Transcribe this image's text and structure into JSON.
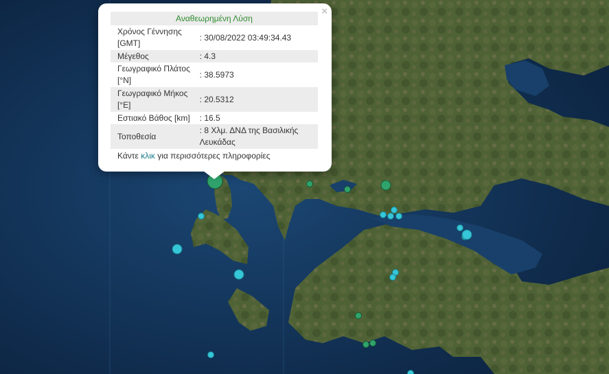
{
  "popup": {
    "title": "Αναθεωρημένη Λύση",
    "close_label": "×",
    "rows": [
      {
        "label": "Χρόνος Γέννησης [GMT]",
        "value": ": 30/08/2022 03:49:34.43"
      },
      {
        "label": "Μέγεθος",
        "value": ": 4.3"
      },
      {
        "label": "Γεωγραφικό Πλάτος [°N]",
        "value": ": 38.5973"
      },
      {
        "label": "Γεωγραφικό Μήκος [°E]",
        "value": ": 20.5312"
      },
      {
        "label": "Εστιακό Βάθος [km]",
        "value": ": 16.5"
      },
      {
        "label": "Τοποθεσία",
        "value": ": 8 Χλμ. ΔΝΔ της Βασιλικής Λευκάδας"
      }
    ],
    "more_prefix": "Κάντε ",
    "more_link": "κλικ",
    "more_suffix": " για περισσότερες πληροφορίες"
  },
  "map": {
    "colors": {
      "sea": "#0f2a4a",
      "land": "#4a5d33",
      "event_green": "#2fa36b",
      "event_cyan": "#35c6d8"
    },
    "events": [
      {
        "kind": "green-large",
        "selected": true
      },
      {
        "kind": "green-small"
      },
      {
        "kind": "green-small"
      },
      {
        "kind": "green-medium"
      },
      {
        "kind": "cyan-small"
      },
      {
        "kind": "cyan-small"
      },
      {
        "kind": "cyan-small"
      },
      {
        "kind": "cyan-small"
      },
      {
        "kind": "cyan-small"
      },
      {
        "kind": "cyan-small"
      },
      {
        "kind": "cyan-medium"
      },
      {
        "kind": "cyan-medium"
      },
      {
        "kind": "cyan-small"
      },
      {
        "kind": "cyan-medium"
      },
      {
        "kind": "cyan-small"
      },
      {
        "kind": "cyan-small"
      },
      {
        "kind": "green-small"
      },
      {
        "kind": "green-small"
      },
      {
        "kind": "green-small"
      },
      {
        "kind": "cyan-small"
      },
      {
        "kind": "cyan-small"
      }
    ]
  }
}
